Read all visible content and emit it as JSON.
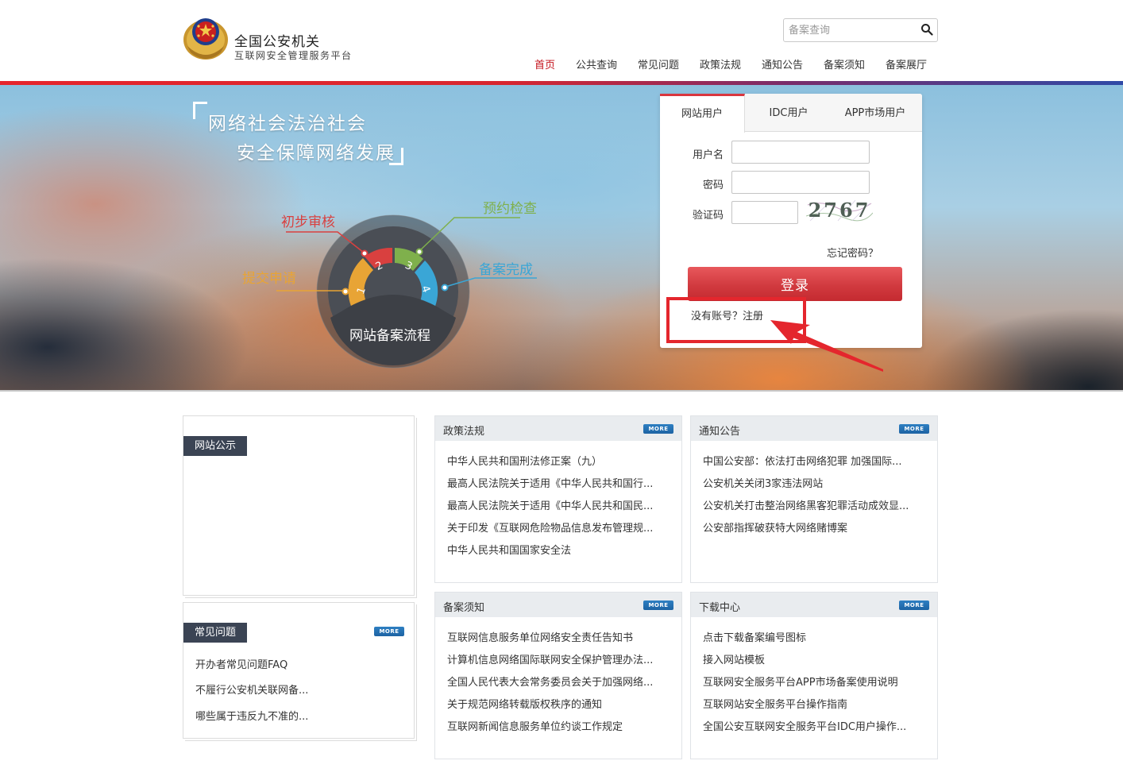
{
  "header": {
    "logo_title": "全国公安机关",
    "logo_subtitle": "互联网安全管理服务平台",
    "search_placeholder": "备案查询",
    "nav": [
      "首页",
      "公共查询",
      "常见问题",
      "政策法规",
      "通知公告",
      "备案须知",
      "备案展厅"
    ]
  },
  "banner": {
    "slogan_line1": "网络社会法治社会",
    "slogan_line2": "安全保障网络发展",
    "flow_title": "网站备案流程",
    "steps": [
      {
        "num": "1",
        "label": "提交申请",
        "color": "#e8a435"
      },
      {
        "num": "2",
        "label": "初步审核",
        "color": "#d9403f"
      },
      {
        "num": "3",
        "label": "预约检查",
        "color": "#7fb04c"
      },
      {
        "num": "4",
        "label": "备案完成",
        "color": "#3aa6d6"
      }
    ]
  },
  "login": {
    "tabs": [
      "网站用户",
      "IDC用户",
      "APP市场用户"
    ],
    "username_label": "用户名",
    "password_label": "密码",
    "captcha_label": "验证码",
    "captcha_text": "2767",
    "forgot": "忘记密码？",
    "login_button": "登录",
    "register": "没有账号？注册"
  },
  "sidebar": {
    "notice_label": "网站公示",
    "faq_label": "常见问题",
    "faq_more": "MORE",
    "faq_items": [
      "开办者常见问题FAQ",
      "不履行公安机关联网备...",
      "哪些属于违反九不准的..."
    ]
  },
  "panels": [
    {
      "title": "政策法规",
      "more": "MORE",
      "items": [
        "中华人民共和国刑法修正案（九）",
        "最高人民法院关于适用《中华人民共和国行...",
        "最高人民法院关于适用《中华人民共和国民...",
        "关于印发《互联网危险物品信息发布管理规...",
        "中华人民共和国国家安全法"
      ]
    },
    {
      "title": "通知公告",
      "more": "MORE",
      "items": [
        "中国公安部：依法打击网络犯罪 加强国际...",
        "公安机关关闭3家违法网站",
        "公安机关打击整治网络黑客犯罪活动成效显...",
        "公安部指挥破获特大网络赌博案"
      ]
    },
    {
      "title": "备案须知",
      "more": "MORE",
      "items": [
        "互联网信息服务单位网络安全责任告知书",
        "计算机信息网络国际联网安全保护管理办法...",
        "全国人民代表大会常务委员会关于加强网络...",
        "关于规范网络转载版权秩序的通知",
        "互联网新闻信息服务单位约谈工作规定"
      ]
    },
    {
      "title": "下载中心",
      "more": "MORE",
      "items": [
        "点击下载备案编号图标",
        "接入网站模板",
        "互联网安全服务平台APP市场备案使用说明",
        "互联网站安全服务平台操作指南",
        "全国公安互联网安全服务平台IDC用户操作..."
      ]
    }
  ]
}
